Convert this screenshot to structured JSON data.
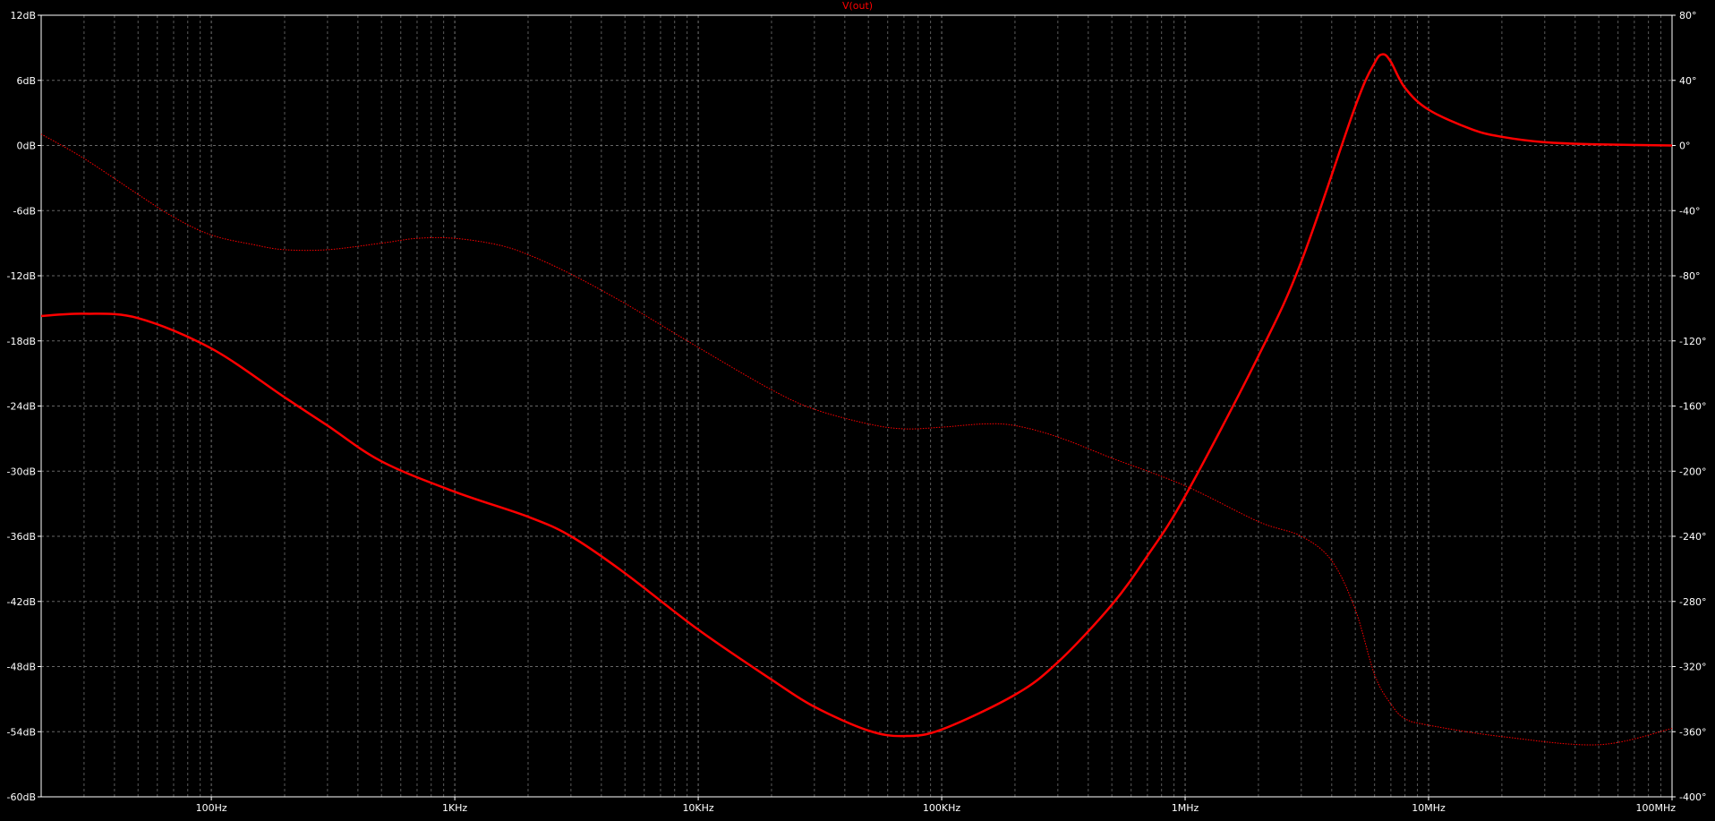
{
  "colors": {
    "background": "#000000",
    "grid": "#808080",
    "trace": "#ff0000",
    "text": "#ffffff",
    "frame": "#ffffff"
  },
  "chart_data": {
    "type": "line",
    "title": "V(out)",
    "x_scale": "log",
    "xlim": [
      20,
      100000000
    ],
    "x_ticks": [
      {
        "value": 100,
        "label": "100Hz"
      },
      {
        "value": 1000,
        "label": "1KHz"
      },
      {
        "value": 10000,
        "label": "10KHz"
      },
      {
        "value": 100000,
        "label": "100KHz"
      },
      {
        "value": 1000000,
        "label": "1MHz"
      },
      {
        "value": 10000000,
        "label": "10MHz"
      },
      {
        "value": 100000000,
        "label": "100MHz"
      }
    ],
    "y_left": {
      "unit": "dB",
      "lim": [
        -60,
        12
      ],
      "ticks": [
        "12dB",
        "6dB",
        "0dB",
        "-6dB",
        "-12dB",
        "-18dB",
        "-24dB",
        "-30dB",
        "-36dB",
        "-42dB",
        "-48dB",
        "-54dB",
        "-60dB"
      ]
    },
    "y_right": {
      "unit": "°",
      "lim": [
        -400,
        80
      ],
      "ticks": [
        "80°",
        "40°",
        "0°",
        "-40°",
        "-80°",
        "-120°",
        "-160°",
        "-200°",
        "-240°",
        "-280°",
        "-320°",
        "-360°",
        "-400°"
      ]
    },
    "grid": true,
    "series": [
      {
        "style": "solid",
        "axis": "left",
        "x": [
          20,
          30,
          50,
          100,
          200,
          300,
          500,
          1000,
          2000,
          3000,
          5000,
          10000,
          20000,
          30000,
          50000,
          70000,
          100000,
          200000,
          300000,
          500000,
          700000,
          1000000,
          2000000,
          3000000,
          5000000,
          6000000,
          6500000,
          7000000,
          8000000,
          10000000,
          15000000,
          20000000,
          30000000,
          50000000,
          100000000
        ],
        "y": [
          -15.7,
          -15.5,
          -15.9,
          -18.7,
          -23.2,
          -25.8,
          -29.1,
          -31.9,
          -34.2,
          -36.0,
          -39.4,
          -44.6,
          -49.2,
          -51.7,
          -53.9,
          -54.4,
          -53.8,
          -50.6,
          -47.6,
          -42.3,
          -37.8,
          -32.3,
          -19.4,
          -10.7,
          3.6,
          7.6,
          8.4,
          7.7,
          5.3,
          3.3,
          1.5,
          0.8,
          0.3,
          0.1,
          0.0
        ]
      },
      {
        "style": "dotted",
        "axis": "right",
        "x": [
          20,
          30,
          50,
          70,
          100,
          150,
          200,
          300,
          500,
          700,
          1000,
          1500,
          2000,
          3000,
          5000,
          10000,
          20000,
          30000,
          50000,
          70000,
          100000,
          150000,
          200000,
          300000,
          500000,
          1000000,
          2000000,
          3000000,
          4000000,
          5000000,
          6000000,
          7000000,
          8000000,
          10000000,
          20000000,
          50000000,
          100000000
        ],
        "y": [
          7,
          -8,
          -30,
          -44,
          -55,
          -61,
          -64,
          -64,
          -60,
          -57,
          -57,
          -61,
          -67,
          -79,
          -97,
          -124,
          -150,
          -162,
          -171,
          -174,
          -173,
          -171,
          -172,
          -179,
          -192,
          -209,
          -231,
          -240,
          -255,
          -285,
          -325,
          -343,
          -352,
          -356,
          -363,
          -368,
          -358
        ]
      }
    ]
  }
}
